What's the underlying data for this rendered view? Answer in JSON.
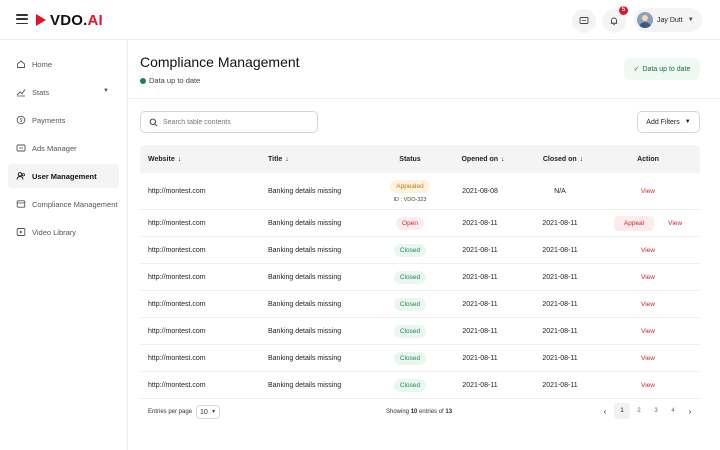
{
  "brand": {
    "name": "VDO.AI",
    "accent": "#e5122a"
  },
  "header": {
    "notification_count": "5",
    "user_name": "Jay Dutt"
  },
  "sidebar": {
    "items": [
      {
        "label": "Home",
        "icon": "home-icon"
      },
      {
        "label": "Stats",
        "icon": "chart-icon",
        "has_submenu": true
      },
      {
        "label": "Payments",
        "icon": "dollar-icon"
      },
      {
        "label": "Ads Manager",
        "icon": "ads-icon"
      },
      {
        "label": "User Management",
        "icon": "users-icon",
        "active": true
      },
      {
        "label": "Compliance Management",
        "icon": "compliance-icon"
      },
      {
        "label": "Video Library",
        "icon": "video-icon"
      }
    ]
  },
  "page": {
    "title": "Compliance Management",
    "subtitle": "Data up to date",
    "status_chip": "Data up to date",
    "search_placeholder": "Search table contents",
    "filters_label": "Add Filters"
  },
  "table": {
    "columns": [
      "Website",
      "Title",
      "Status",
      "Opened on",
      "Closed on",
      "Action"
    ],
    "rows": [
      {
        "website": "http://montest.com",
        "title": "Banking details missing",
        "status": "Appealed",
        "status_id": "ID : VDO-323",
        "opened": "2021-08-08",
        "closed": "N/A",
        "appeal": "",
        "action": "View"
      },
      {
        "website": "http://montest.com",
        "title": "Banking details missing",
        "status": "Open",
        "status_id": "",
        "opened": "2021-08-11",
        "closed": "2021-08-11",
        "appeal": "Appeal",
        "action": "View"
      },
      {
        "website": "http://montest.com",
        "title": "Banking details missing",
        "status": "Closed",
        "status_id": "",
        "opened": "2021-08-11",
        "closed": "2021-08-11",
        "appeal": "",
        "action": "View"
      },
      {
        "website": "http://montest.com",
        "title": "Banking details missing",
        "status": "Closed",
        "status_id": "",
        "opened": "2021-08-11",
        "closed": "2021-08-11",
        "appeal": "",
        "action": "View"
      },
      {
        "website": "http://montest.com",
        "title": "Banking details missing",
        "status": "Closed",
        "status_id": "",
        "opened": "2021-08-11",
        "closed": "2021-08-11",
        "appeal": "",
        "action": "View"
      },
      {
        "website": "http://montest.com",
        "title": "Banking details missing",
        "status": "Closed",
        "status_id": "",
        "opened": "2021-08-11",
        "closed": "2021-08-11",
        "appeal": "",
        "action": "View"
      },
      {
        "website": "http://montest.com",
        "title": "Banking details missing",
        "status": "Closed",
        "status_id": "",
        "opened": "2021-08-11",
        "closed": "2021-08-11",
        "appeal": "",
        "action": "View"
      },
      {
        "website": "http://montest.com",
        "title": "Banking details missing",
        "status": "Closed",
        "status_id": "",
        "opened": "2021-08-11",
        "closed": "2021-08-11",
        "appeal": "",
        "action": "View"
      }
    ]
  },
  "footer": {
    "entries_label": "Entries per page",
    "per_page": "10",
    "showing_prefix": "Showing",
    "showing_count": "10",
    "showing_mid": "entries of",
    "showing_total": "13",
    "pages": [
      "1",
      "2",
      "3",
      "4"
    ],
    "current_page": "1"
  },
  "colors": {
    "closed": "#1f8a55",
    "open": "#d01f2f",
    "appealed": "#b7791f",
    "up_to_date": "#17805a"
  }
}
